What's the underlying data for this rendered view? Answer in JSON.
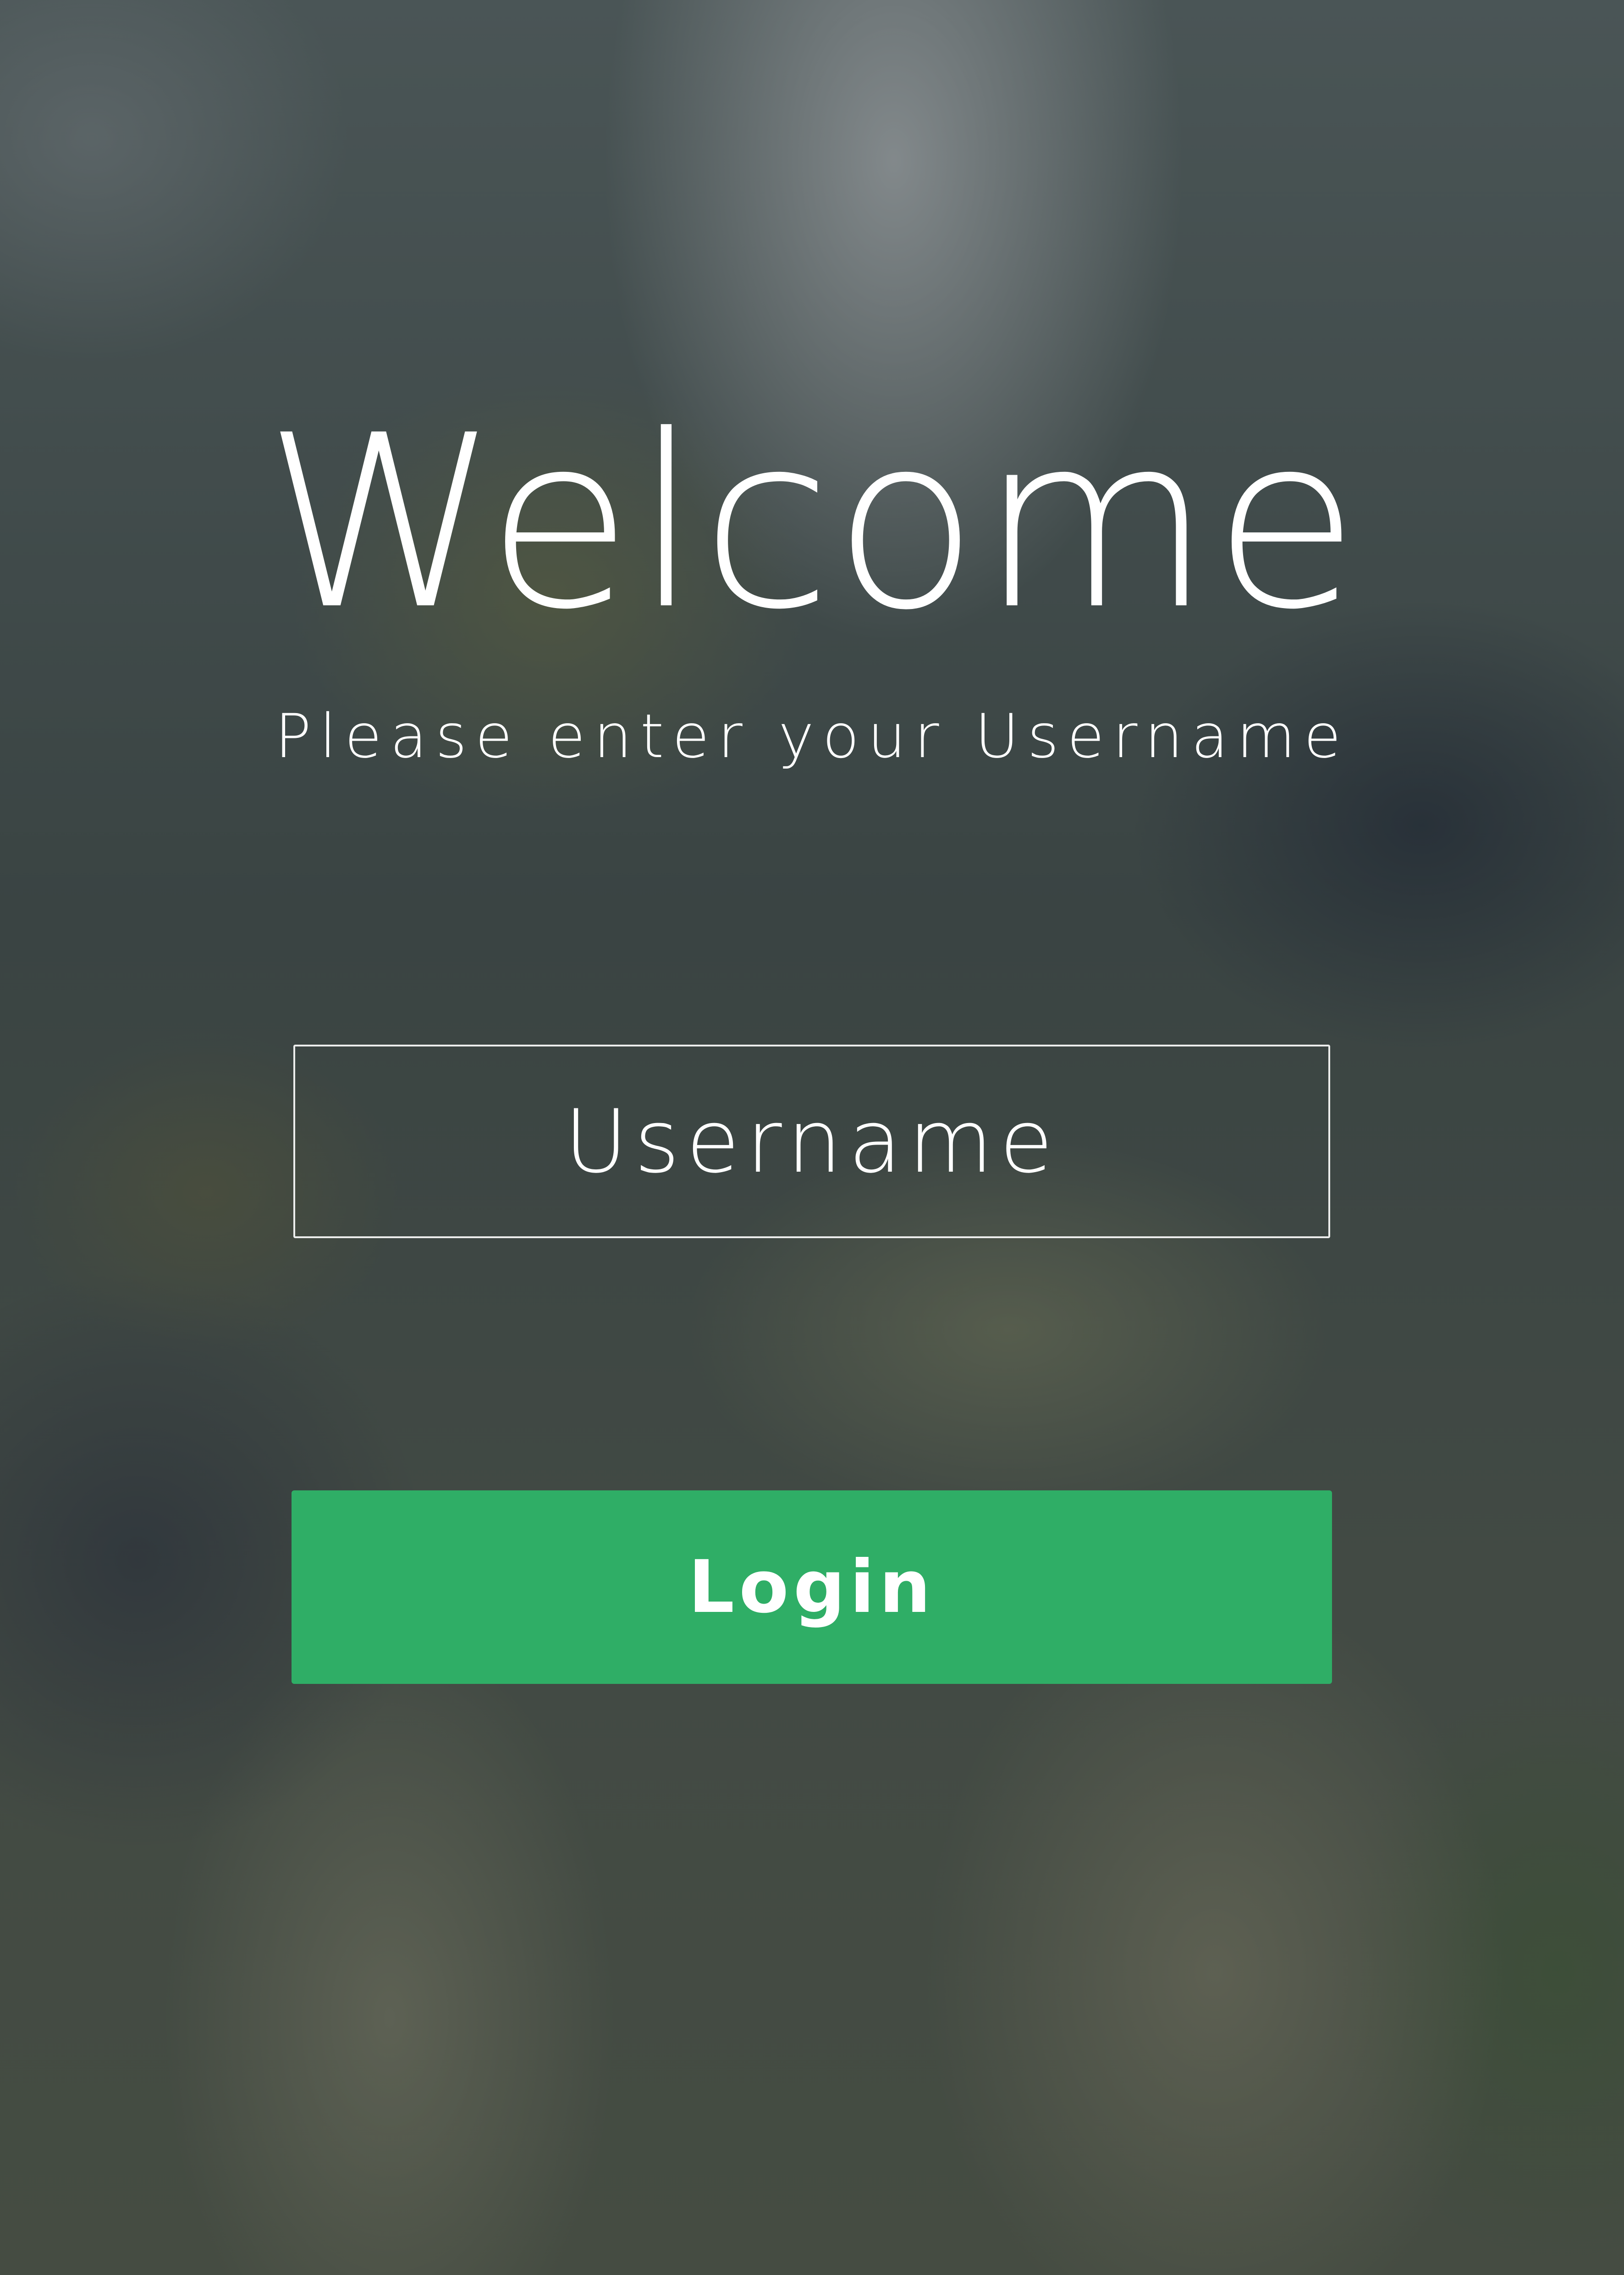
{
  "welcome": {
    "title": "Welcome",
    "subtitle": "Please enter your Username"
  },
  "form": {
    "username_placeholder": "Username",
    "username_value": "",
    "login_label": "Login"
  },
  "colors": {
    "login_button": "#2fae66",
    "text": "#ffffff",
    "input_border": "#ffffff"
  }
}
